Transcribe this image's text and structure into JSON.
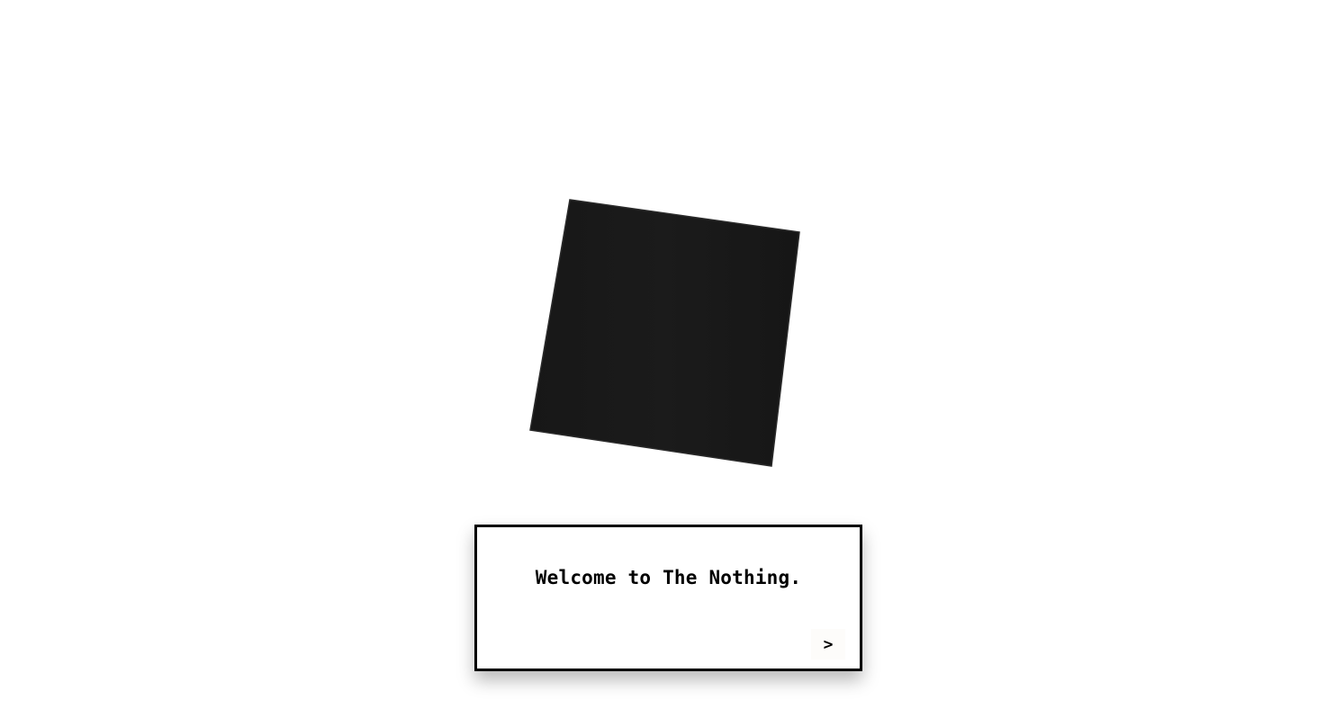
{
  "scene": {
    "background_color": "#ffffff",
    "object_color": "#1a1a1a",
    "object_edge_color": "#2b2b2b"
  },
  "dialog": {
    "message": "Welcome to The Nothing.",
    "next_label": ">"
  }
}
